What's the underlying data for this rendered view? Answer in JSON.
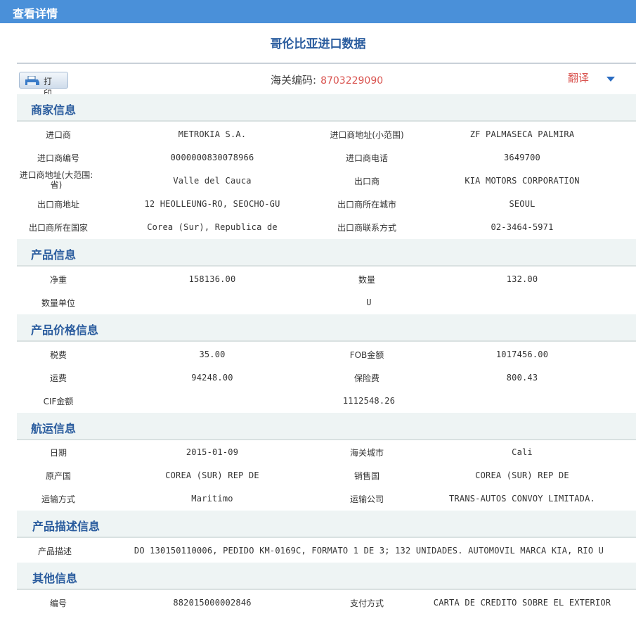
{
  "window": {
    "title": "查看详情"
  },
  "page": {
    "title": "哥伦比亚进口数据"
  },
  "toolbar": {
    "print_label": "打 印",
    "hs_code_label": "海关编码:",
    "hs_code_value": "8703229090",
    "translate_label": "翻译"
  },
  "sections": {
    "merchant": {
      "title": "商家信息",
      "importer_label": "进口商",
      "importer": "METROKIA S.A.",
      "importer_addr_small_label": "进口商地址(小范围)",
      "importer_addr_small": "ZF PALMASECA PALMIRA",
      "importer_no_label": "进口商编号",
      "importer_no": "0000000830078966",
      "importer_phone_label": "进口商电话",
      "importer_phone": "3649700",
      "importer_addr_large_label_1": "进口商地址(大范围:",
      "importer_addr_large_label_2": "省)",
      "importer_addr_large": "Valle del Cauca",
      "exporter_label": "出口商",
      "exporter": "KIA MOTORS CORPORATION",
      "exporter_addr_label": "出口商地址",
      "exporter_addr": "12 HEOLLEUNG-RO, SEOCHO-GU",
      "exporter_city_label": "出口商所在城市",
      "exporter_city": "SEOUL",
      "exporter_country_label": "出口商所在国家",
      "exporter_country": "Corea (Sur), Republica de",
      "exporter_contact_label": "出口商联系方式",
      "exporter_contact": "02-3464-5971"
    },
    "product": {
      "title": "产品信息",
      "net_weight_label": "净重",
      "net_weight": "158136.00",
      "quantity_label": "数量",
      "quantity": "132.00",
      "unit_label": "数量单位",
      "unit": "U"
    },
    "price": {
      "title": "产品价格信息",
      "tax_label": "税费",
      "tax": "35.00",
      "fob_label": "FOB金额",
      "fob": "1017456.00",
      "freight_label": "运费",
      "freight": "94248.00",
      "insurance_label": "保险费",
      "insurance": "800.43",
      "cif_label": "CIF金额",
      "cif": "1112548.26"
    },
    "shipping": {
      "title": "航运信息",
      "date_label": "日期",
      "date": "2015-01-09",
      "customs_city_label": "海关城市",
      "customs_city": "Cali",
      "origin_label": "原产国",
      "origin": "COREA (SUR) REP DE",
      "sale_country_label": "销售国",
      "sale_country": "COREA (SUR) REP DE",
      "transport_label": "运输方式",
      "transport": "Maritimo",
      "carrier_label": "运输公司",
      "carrier": "TRANS-AUTOS CONVOY LIMITADA."
    },
    "description": {
      "title": "产品描述信息",
      "desc_label": "产品描述",
      "desc": "DO 130150110006, PEDIDO KM-0169C, FORMATO 1 DE 3; 132 UNIDADES. AUTOMOVIL MARCA KIA, RIO U"
    },
    "other": {
      "title": "其他信息",
      "no_label": "编号",
      "no": "882015000002846",
      "payment_label": "支付方式",
      "payment": "CARTA DE CREDITO SOBRE EL EXTERIOR"
    }
  }
}
